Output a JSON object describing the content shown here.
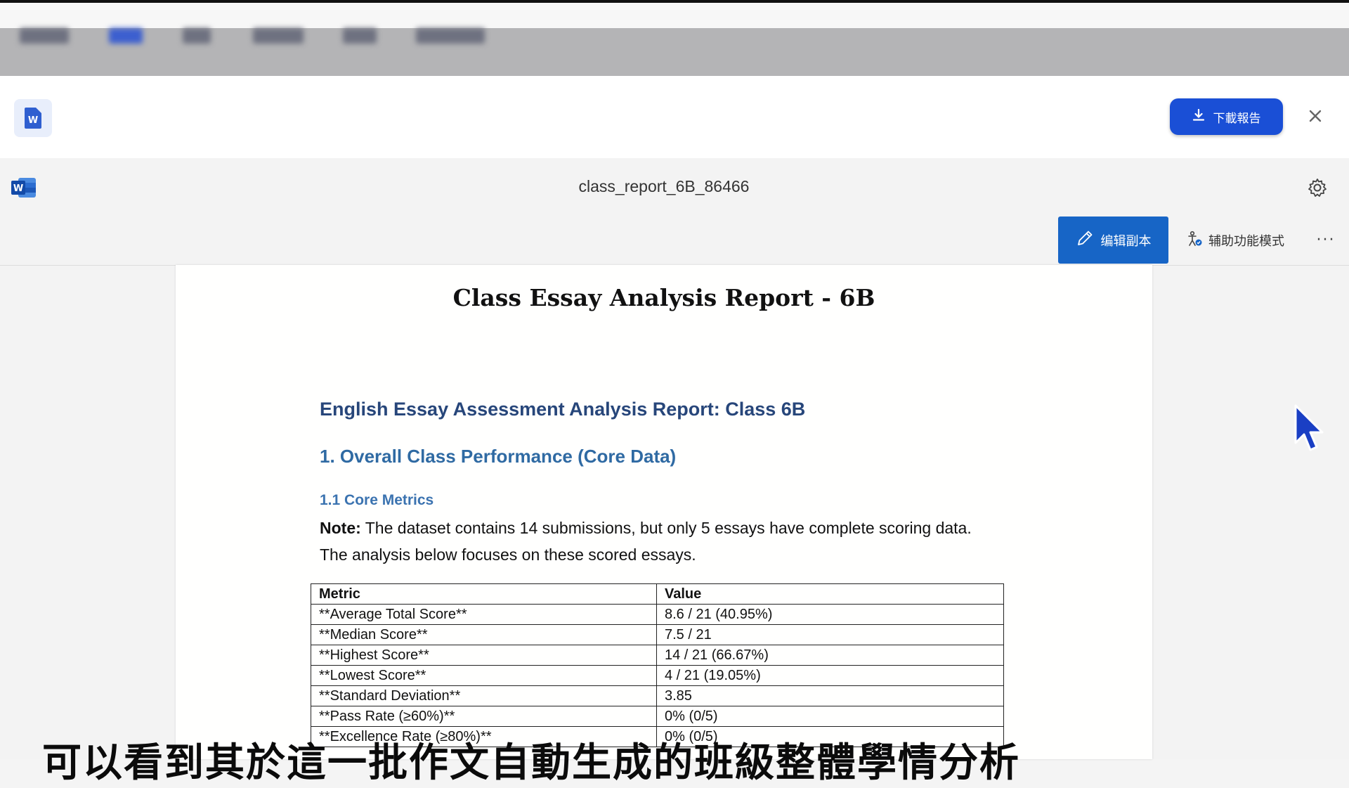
{
  "header": {
    "download_label": "下載報告"
  },
  "viewer": {
    "document_name": "class_report_6B_86466",
    "edit_copy_label": "编辑副本",
    "accessibility_label": "辅助功能模式",
    "more_label": "···"
  },
  "document": {
    "title": "Class Essay Analysis Report - 6B",
    "heading1": "English Essay Assessment Analysis Report: Class 6B",
    "heading2": "1. Overall Class Performance (Core Data)",
    "heading3": "1.1 Core Metrics",
    "note_label": "Note:",
    "note_text": " The dataset contains 14 submissions, but only 5 essays have complete scoring data. The analysis below focuses on these scored essays.",
    "table": {
      "headers": [
        "Metric",
        "Value"
      ],
      "rows": [
        [
          "**Average Total Score**",
          "8.6 / 21 (40.95%)"
        ],
        [
          "**Median Score**",
          "7.5 / 21"
        ],
        [
          "**Highest Score**",
          "14 / 21 (66.67%)"
        ],
        [
          "**Lowest Score**",
          "4 / 21 (19.05%)"
        ],
        [
          "**Standard Deviation**",
          "3.85"
        ],
        [
          "**Pass Rate (≥60%)**",
          "0% (0/5)"
        ],
        [
          "**Excellence Rate (≥80%)**",
          "0% (0/5)"
        ]
      ]
    }
  },
  "caption": {
    "text": "可以看到其於這一批作文自動生成的班級整體學情分析"
  },
  "colors": {
    "accent_blue": "#1a4fd6",
    "edit_blue": "#1765c6",
    "heading_dark": "#27467a",
    "heading_light": "#2f6aa3"
  },
  "icons": {
    "file": "word-file-icon",
    "app": "word-app-icon",
    "download": "download-icon",
    "close": "close-icon",
    "settings": "gear-icon",
    "edit": "pencil-icon",
    "accessibility": "accessibility-icon",
    "cursor": "mouse-pointer-icon"
  }
}
